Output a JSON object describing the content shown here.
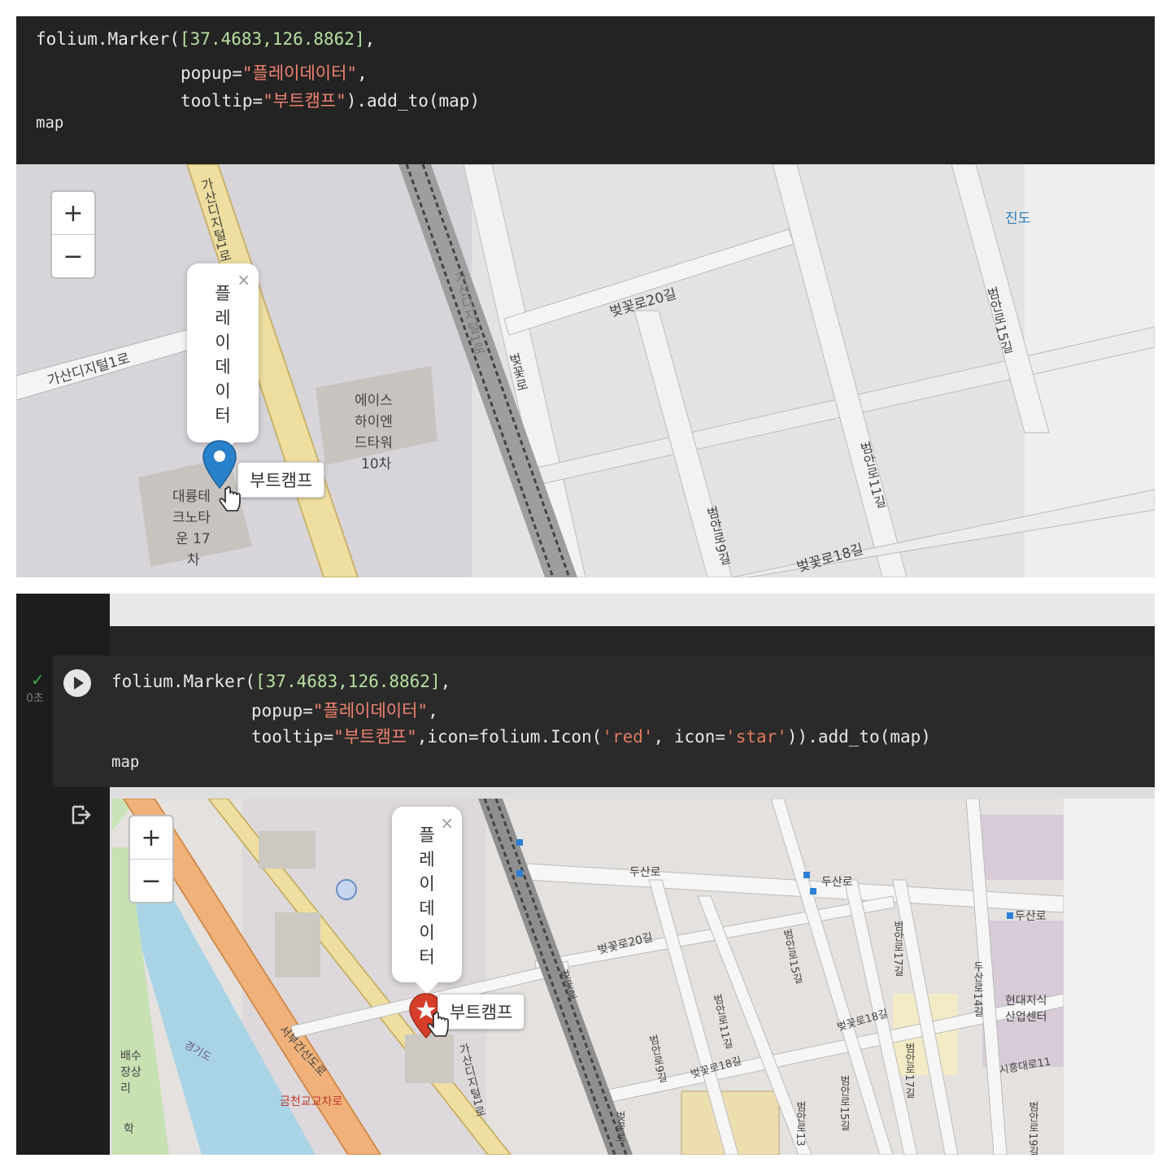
{
  "top": {
    "code": {
      "l1_fn": "folium.Marker(",
      "l1_coords": "[37.4683,126.8862]",
      "l1_end": ",",
      "l2_key": "popup=",
      "l2_val": "\"플레이데이터\"",
      "l2_end": ",",
      "l3_key": "tooltip=",
      "l3_val": "\"부트캠프\"",
      "l3_end": ").add_to(map)",
      "l4": "map"
    },
    "map": {
      "zoom_in": "+",
      "zoom_out": "−",
      "popup_chars": [
        "플",
        "레",
        "이",
        "데",
        "이",
        "터"
      ],
      "popup_close": "×",
      "tooltip": "부트캠프",
      "marker_color": "#2a81cb",
      "labels": {
        "road1": "가산디지털1로",
        "road2": "가산디지털1로",
        "building1": "에이스",
        "building2": "하이엔",
        "building3": "드타워",
        "building4": "10차",
        "building5": "대륭테",
        "building6": "크노타",
        "building7": "운 17",
        "building8": "차",
        "street1": "벚꽃로20길",
        "street2": "벚꽃로",
        "street3": "범안로15길",
        "street4": "범안로11길",
        "street5": "범안로9길",
        "street6": "벚꽃로18길",
        "street7": "진도",
        "street8": "가산디지털1로"
      }
    }
  },
  "bottom": {
    "gutter": {
      "check": "✓",
      "time": "0초"
    },
    "code": {
      "l1_fn": "folium.Marker(",
      "l1_coords": "[37.4683,126.8862]",
      "l1_end": ",",
      "l2_key": "popup=",
      "l2_val": "\"플레이데이터\"",
      "l2_end": ",",
      "l3_key": "tooltip=",
      "l3_val": "\"부트캠프\"",
      "l3_mid": ",icon=folium.Icon(",
      "l3_red": "'red'",
      "l3_sep": ", icon=",
      "l3_star": "'star'",
      "l3_end": ")).add_to(map)",
      "l4": "map"
    },
    "map": {
      "zoom_in": "+",
      "zoom_out": "−",
      "popup_chars": [
        "플",
        "레",
        "이",
        "데",
        "이",
        "터"
      ],
      "popup_close": "×",
      "tooltip": "부트캠프",
      "marker_color": "#d63e2a",
      "labels": {
        "road_duksan1": "두산로",
        "road_duksan2": "두산로",
        "road_duksan3": "두산로",
        "beot20": "벚꽃로20길",
        "beot": "벚꽃로",
        "beom15": "범안로15길",
        "beom17": "범안로17길",
        "beom11": "범안로11길",
        "beot18a": "벚꽃로18길",
        "beom9": "범안로9길",
        "beot18b": "벚꽃로18길",
        "beom17b": "범안로17길",
        "beom15b": "범안로15길",
        "beom13": "범안로13",
        "gasan": "가산디지털1로",
        "seobu": "서부간선도로",
        "geumcheon": "금천교교차로",
        "hyundai1": "현대지식",
        "hyundai2": "산업센터",
        "duksan14": "두산로14길",
        "sidae": "시흥대로11",
        "beom19": "범안로19길",
        "gyeonggi": "경기도",
        "baesu1": "배수",
        "baesu2": "장상",
        "baesu3": "리",
        "hak": "학",
        "beotkkot": "벚꽃로"
      }
    }
  }
}
